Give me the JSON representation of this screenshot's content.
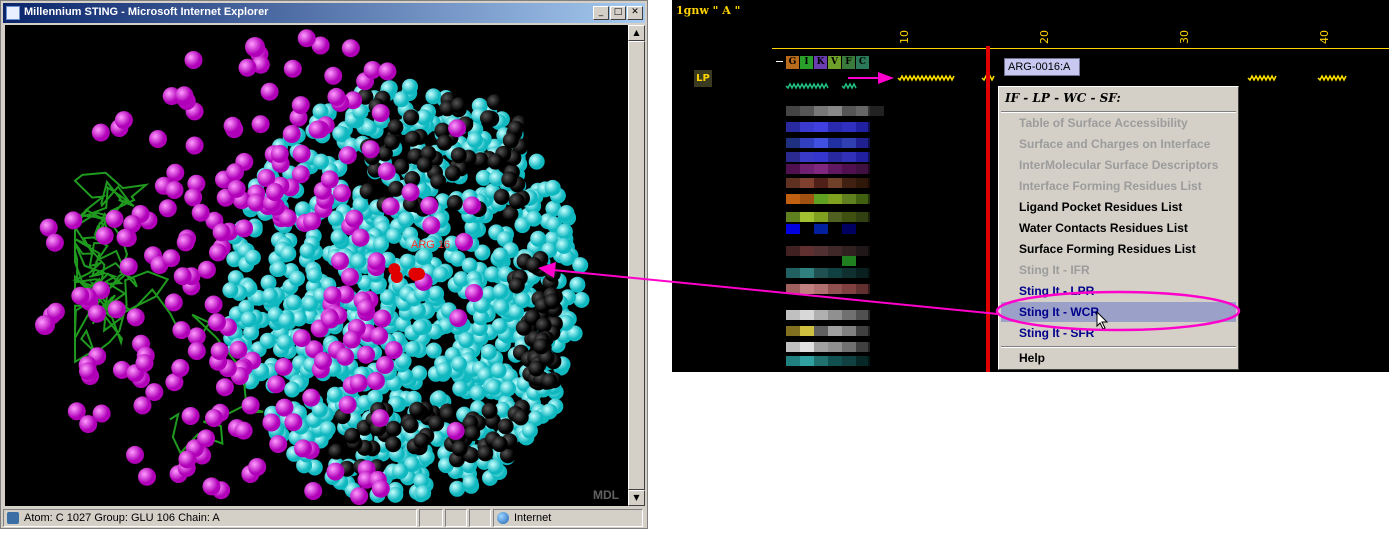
{
  "browser": {
    "title": "Millennium STING - Microsoft Internet Explorer",
    "watermark": "MDL",
    "status": {
      "atom_info": "Atom: C  1027  Group: GLU 106  Chain: A",
      "zone": "Internet"
    }
  },
  "molecule": {
    "highlight_label": "ARG 16",
    "colors": {
      "background": "#000000",
      "surface_atoms": "#22e0e0",
      "interface_atoms": "#e000e0",
      "backbone": "#1f9a1f",
      "pocket_atoms": "#000000",
      "selected_residue": "#e00000"
    }
  },
  "sting": {
    "sequence_title": "1gnw \" A \"",
    "ruler_ticks": [
      "10",
      "20",
      "30",
      "40"
    ],
    "track_label": "LP",
    "residues": [
      "G",
      "I",
      "K",
      "V",
      "F",
      "C"
    ],
    "tooltip": "ARG-0016:A",
    "menu": {
      "header": "IF - LP - WC - SF:",
      "items": [
        {
          "label": "Table of Surface Accessibility",
          "state": "disabled"
        },
        {
          "label": "Surface and Charges on Interface",
          "state": "disabled"
        },
        {
          "label": "InterMolecular Surface Descriptors",
          "state": "disabled"
        },
        {
          "label": "Interface Forming Residues List",
          "state": "disabled"
        },
        {
          "label": "Ligand Pocket Residues List",
          "state": "enabled"
        },
        {
          "label": "Water Contacts Residues List",
          "state": "enabled"
        },
        {
          "label": "Surface Forming Residues List",
          "state": "enabled"
        },
        {
          "label": "Sting It - IFR",
          "state": "disabled"
        },
        {
          "label": "Sting It - LPR",
          "state": "sting"
        },
        {
          "label": "Sting It - WCR",
          "state": "sting-highlight"
        },
        {
          "label": "Sting It - SFR",
          "state": "sting"
        }
      ],
      "help": "Help"
    },
    "colors": {
      "ruler": "#ffd400",
      "cursor_line": "#e00000",
      "annotation_arrow": "#ff00cc",
      "menu_highlight": "#9aa0c8"
    }
  }
}
